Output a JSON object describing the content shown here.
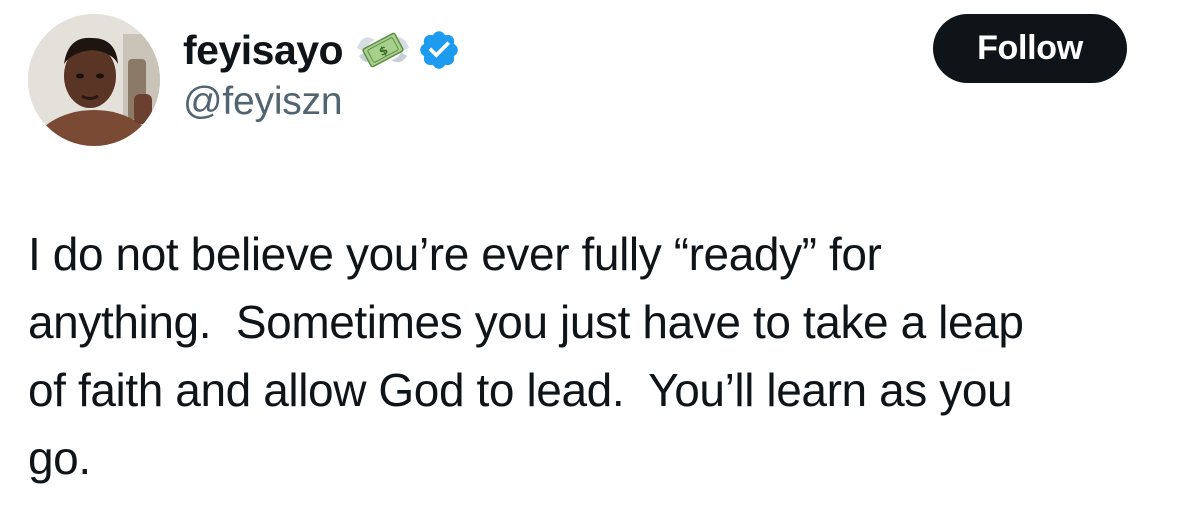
{
  "author": {
    "display_name": "feyisayo",
    "handle": "@feyiszn",
    "name_emoji_icon": "money-with-wings-icon",
    "verified_badge_icon": "verified-badge-icon",
    "verified_color": "#1d9bf0"
  },
  "follow_button": {
    "label": "Follow"
  },
  "tweet": {
    "lines": [
      "I do not believe you’re ever fully “ready” for",
      "anything.  Sometimes you just have to take a leap",
      "of faith and allow God to lead.  You’ll learn as you",
      "go."
    ]
  },
  "colors": {
    "text_primary": "#0f1419",
    "text_secondary": "#536471",
    "button_bg": "#0f1419",
    "button_text": "#ffffff"
  }
}
